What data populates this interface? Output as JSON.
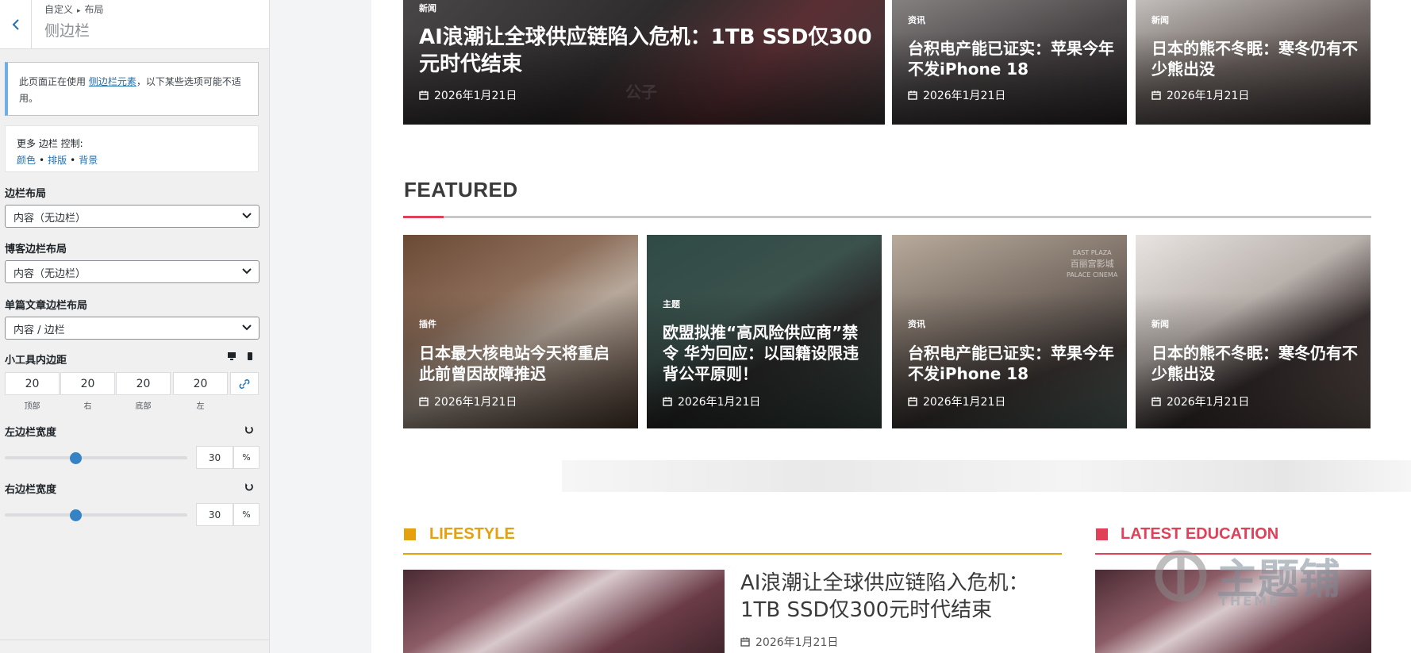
{
  "customizer": {
    "breadcrumb_root": "自定义",
    "breadcrumb_sep": "▸",
    "breadcrumb_leaf": "布局",
    "panel_title": "侧边栏",
    "notice_prefix": "此页面正在使用",
    "notice_link": "侧边栏元素",
    "notice_suffix": "，以下某些选项可能不适用。",
    "more_label": "更多 边栏 控制:",
    "more_link_color": "颜色",
    "more_link_typography": "排版",
    "more_link_background": "背景",
    "link_dot": "•",
    "sidebar_layout_label": "边栏布局",
    "sidebar_layout_value": "内容（无边栏）",
    "blog_sidebar_label": "博客边栏布局",
    "blog_sidebar_value": "内容（无边栏）",
    "single_sidebar_label": "单篇文章边栏布局",
    "single_sidebar_value": "内容 / 边栏",
    "widget_padding_label": "小工具内边距",
    "padding_values": [
      "20",
      "20",
      "20",
      "20"
    ],
    "padding_captions": [
      "顶部",
      "右",
      "底部",
      "左"
    ],
    "left_width_label": "左边栏宽度",
    "left_width_value": "30",
    "left_width_unit": "%",
    "left_width_fraction": 0.39,
    "right_width_label": "右边栏宽度",
    "right_width_value": "30",
    "right_width_unit": "%",
    "right_width_fraction": 0.39,
    "accent_color": "#2271b1"
  },
  "site": {
    "top_row": [
      {
        "category": "新闻",
        "title": "AI浪潮让全球供应链陷入危机：1TB SSD仅300元时代结束",
        "date": "2026年1月21日",
        "watermark": "公子"
      },
      {
        "category": "资讯",
        "title": "台积电产能已证实：苹果今年不发iPhone 18",
        "date": "2026年1月21日"
      },
      {
        "category": "新闻",
        "title": "日本的熊不冬眠：寒冬仍有不少熊出没",
        "date": "2026年1月21日"
      }
    ],
    "featured_heading": "FEATURED",
    "featured_accent": "#e04058",
    "featured": [
      {
        "category": "插件",
        "title": "日本最大核电站今天将重启 此前曾因故障推迟",
        "date": "2026年1月21日"
      },
      {
        "category": "主题",
        "title": "欧盟拟推“高风险供应商”禁令 华为回应：以国籍设限违背公平原则！",
        "date": "2026年1月21日"
      },
      {
        "category": "资讯",
        "title": "台积电产能已证实：苹果今年不发iPhone 18",
        "date": "2026年1月21日",
        "sign_1": "EAST PLAZA",
        "sign_2": "百丽宫影城",
        "sign_3": "PALACE CINEMA"
      },
      {
        "category": "新闻",
        "title": "日本的熊不冬眠：寒冬仍有不少熊出没",
        "date": "2026年1月21日"
      }
    ],
    "lifestyle_heading": "LIFESTYLE",
    "lifestyle_color": "#e5a00d",
    "lifestyle_post": {
      "title": "AI浪潮让全球供应链陷入危机：1TB SSD仅300元时代结束",
      "date": "2026年1月21日"
    },
    "education_heading": "LATEST EDUCATION",
    "education_color": "#e04058",
    "logo_watermark": "主题铺",
    "logo_sub": "THEME"
  }
}
